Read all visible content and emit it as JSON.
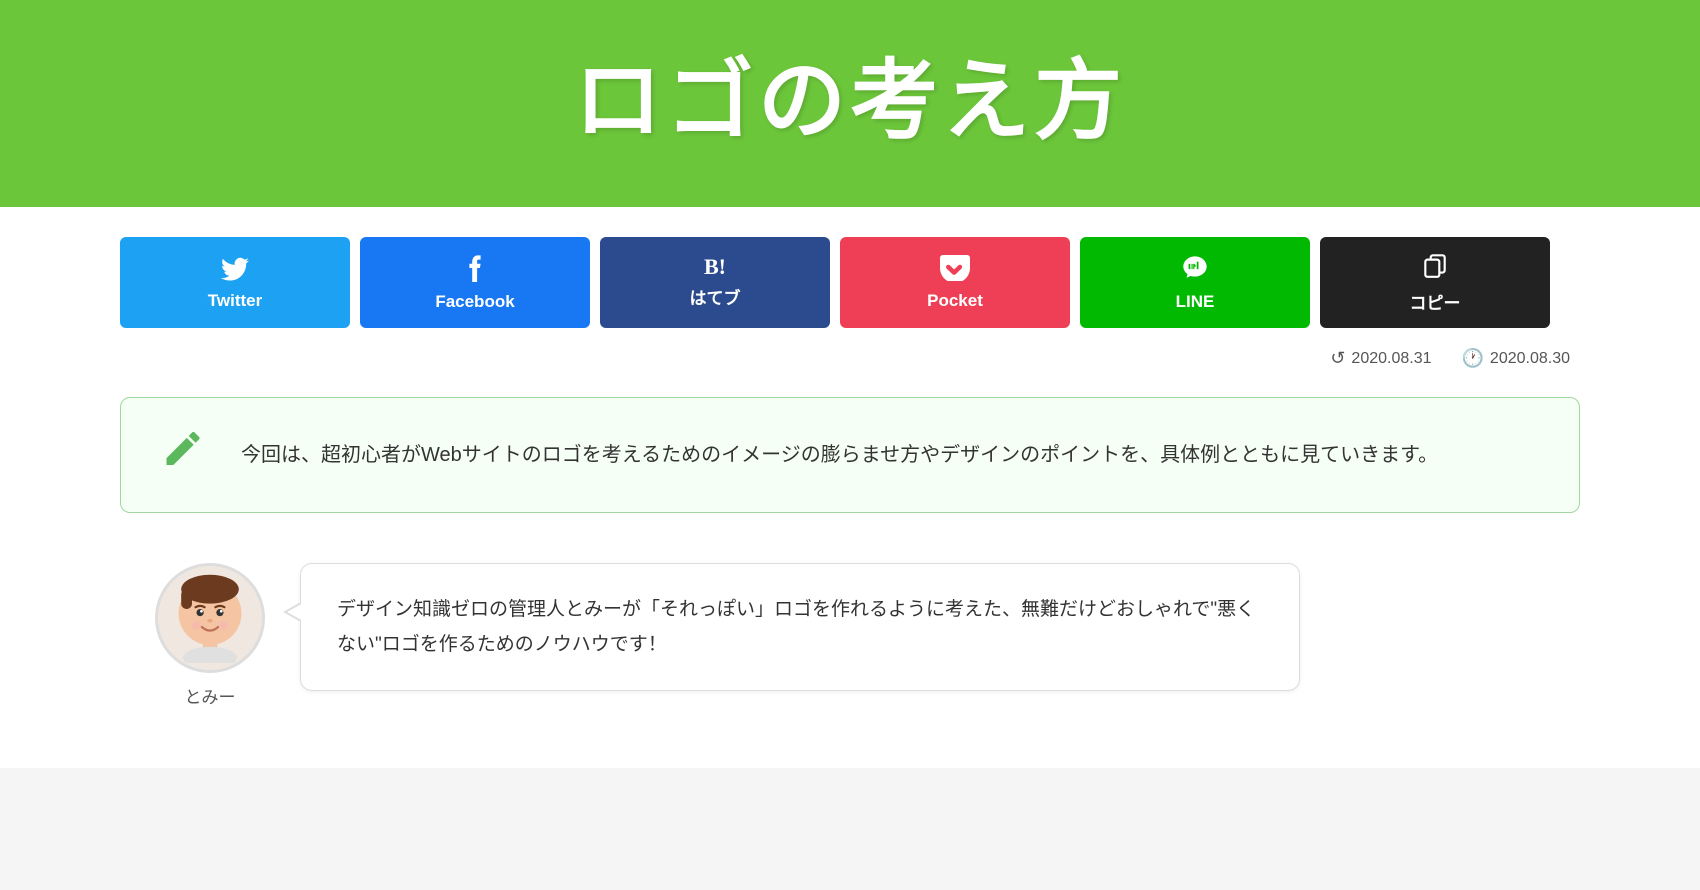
{
  "hero": {
    "title": "ロゴの考え方"
  },
  "share_buttons": [
    {
      "id": "twitter",
      "label": "Twitter",
      "icon": "𝕏",
      "class": "btn-twitter"
    },
    {
      "id": "facebook",
      "label": "Facebook",
      "icon": "f",
      "class": "btn-facebook"
    },
    {
      "id": "hatena",
      "label": "はてブ",
      "icon": "B!",
      "class": "btn-hatena"
    },
    {
      "id": "pocket",
      "label": "Pocket",
      "icon": "🏷",
      "class": "btn-pocket"
    },
    {
      "id": "line",
      "label": "LINE",
      "icon": "LINE",
      "class": "btn-line"
    },
    {
      "id": "copy",
      "label": "コピー",
      "icon": "⧉",
      "class": "btn-copy"
    }
  ],
  "dates": {
    "updated_icon": "↺",
    "updated": "2020.08.31",
    "published_icon": "🕐",
    "published": "2020.08.30"
  },
  "summary": {
    "text": "今回は、超初心者がWebサイトのロゴを考えるためのイメージの膨らませ方やデザインのポイントを、具体例とともに見ていきます。"
  },
  "chat": {
    "avatar_alt": "とみー",
    "author": "とみー",
    "message": "デザイン知識ゼロの管理人とみーが「それっぽい」ロゴを作れるように考えた、無難だけどおしゃれで\"悪くない\"ロゴを作るためのノウハウです！"
  }
}
